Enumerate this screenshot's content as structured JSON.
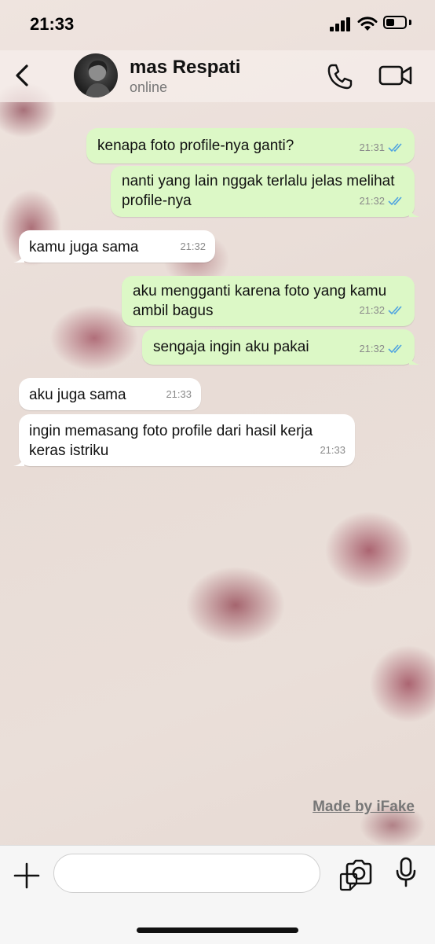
{
  "status_bar": {
    "time": "21:33"
  },
  "contact": {
    "name": "mas Respati",
    "status": "online"
  },
  "messages": [
    {
      "dir": "out",
      "text": "kenapa foto profile-nya ganti?",
      "time": "21:31"
    },
    {
      "dir": "out",
      "text": "nanti yang lain nggak terlalu jelas melihat profile-nya",
      "time": "21:32"
    },
    {
      "dir": "in",
      "text": "kamu juga sama",
      "time": "21:32"
    },
    {
      "dir": "out",
      "text": "aku mengganti karena foto yang kamu ambil bagus",
      "time": "21:32"
    },
    {
      "dir": "out",
      "text": "sengaja ingin aku pakai",
      "time": "21:32"
    },
    {
      "dir": "in",
      "text": "aku juga sama",
      "time": "21:33"
    },
    {
      "dir": "in",
      "text": "ingin memasang foto profile dari hasil kerja keras istriku",
      "time": "21:33"
    }
  ],
  "watermark": "Made by iFake",
  "icons": {
    "back": "chevron-left-icon",
    "call": "phone-icon",
    "video": "video-camera-icon",
    "attach": "plus-icon",
    "sticker": "sticker-icon",
    "camera": "camera-icon",
    "mic": "microphone-icon",
    "read": "double-check-icon"
  },
  "colors": {
    "outgoing_bubble": "#dcf8c6",
    "incoming_bubble": "#ffffff",
    "read_ticks": "#4fa3e0"
  }
}
